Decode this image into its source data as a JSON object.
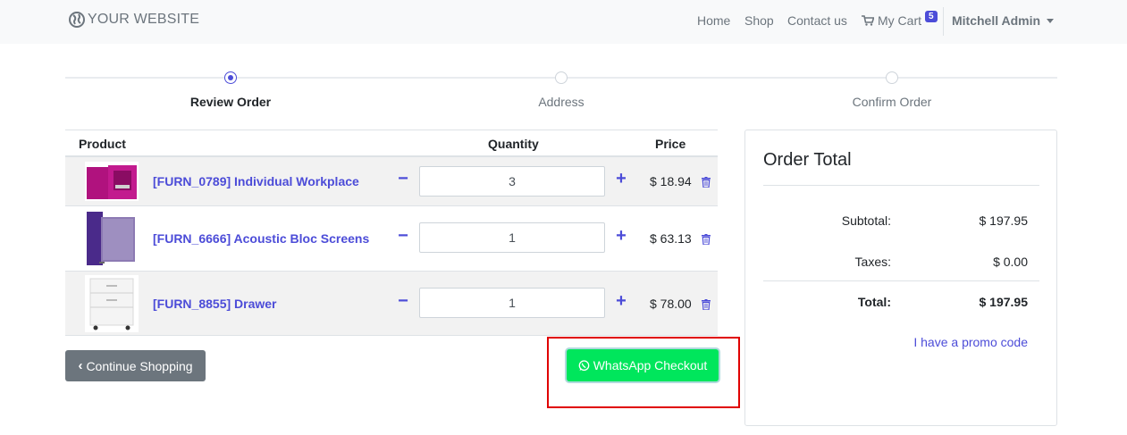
{
  "navbar": {
    "brand": "YOUR WEBSITE",
    "brand_icon": "globe-icon",
    "links": [
      "Home",
      "Shop",
      "Contact us"
    ],
    "cart_label": "My Cart",
    "cart_count": "5",
    "user": "Mitchell Admin"
  },
  "wizard": {
    "steps": [
      "Review Order",
      "Address",
      "Confirm Order"
    ],
    "active_step": 0
  },
  "cart": {
    "headers": {
      "product": "Product",
      "quantity": "Quantity",
      "price": "Price"
    },
    "items": [
      {
        "name": "[FURN_0789] Individual Workplace",
        "quantity": "3",
        "price": "$ 18.94",
        "thumb": "magenta-workplace-booth"
      },
      {
        "name": "[FURN_6666] Acoustic Bloc Screens",
        "quantity": "1",
        "price": "$ 63.13",
        "thumb": "purple-acoustic-screens"
      },
      {
        "name": "[FURN_8855] Drawer",
        "quantity": "1",
        "price": "$ 78.00",
        "thumb": "white-drawer-unit"
      }
    ]
  },
  "actions": {
    "continue_label": "Continue Shopping",
    "whatsapp_label": "WhatsApp Checkout"
  },
  "summary": {
    "title": "Order Total",
    "subtotal_label": "Subtotal:",
    "subtotal_value": "$ 197.95",
    "taxes_label": "Taxes:",
    "taxes_value": "$ 0.00",
    "total_label": "Total:",
    "total_value": "$ 197.95",
    "promo_label": "I have a promo code"
  },
  "colors": {
    "accent": "#4c4cd8",
    "whatsapp": "#00e65c",
    "secondary_button": "#6c757d",
    "highlight": "#e00000"
  }
}
